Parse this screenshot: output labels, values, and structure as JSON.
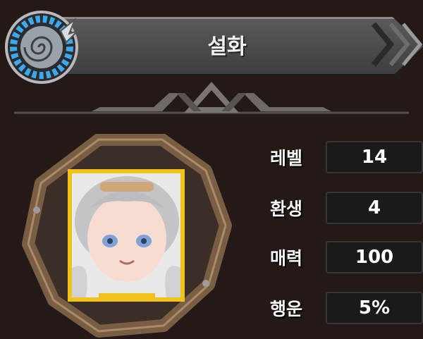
{
  "character": {
    "name": "설화"
  },
  "stats": [
    {
      "label": "레벨",
      "value": "14"
    },
    {
      "label": "환생",
      "value": "4"
    },
    {
      "label": "매력",
      "value": "100"
    },
    {
      "label": "행운",
      "value": "5%"
    }
  ],
  "colors": {
    "background": "#231a17",
    "title_bar": "#4a4a4c",
    "emblem_ring": "#3aa9f0",
    "frame_wood": "#7a5e44",
    "portrait_border": "#f1c21b"
  },
  "icons": {
    "emblem": "winged-spiral-emblem-icon",
    "title_arrow": "chevron-right-icon"
  }
}
